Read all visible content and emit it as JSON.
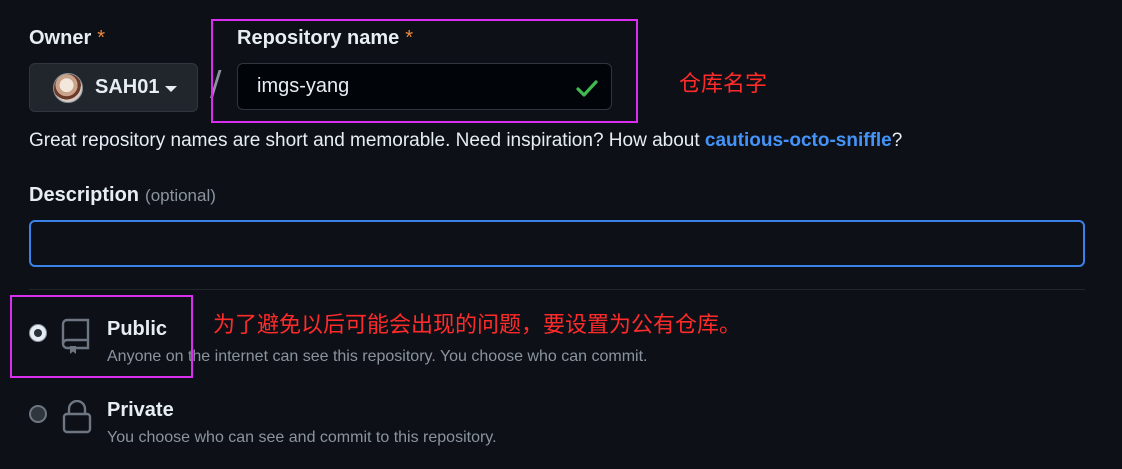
{
  "owner": {
    "label": "Owner",
    "required_mark": "*",
    "selected": "SAH01"
  },
  "separator": "/",
  "repository": {
    "label": "Repository name",
    "required_mark": "*",
    "value": "imgs-yang",
    "status_icon": "check-icon"
  },
  "hint": {
    "text": "Great repository names are short and memorable. Need inspiration? How about ",
    "suggestion": "cautious-octo-sniffle",
    "suffix": "?"
  },
  "description": {
    "label": "Description",
    "optional": "(optional)",
    "value": ""
  },
  "visibility": {
    "selected": "public",
    "options": [
      {
        "id": "public",
        "title": "Public",
        "description": "Anyone on the internet can see this repository. You choose who can commit.",
        "icon": "repo-icon"
      },
      {
        "id": "private",
        "title": "Private",
        "description": "You choose who can see and commit to this repository.",
        "icon": "lock-icon"
      }
    ]
  },
  "annotations": {
    "repo_name_note": "仓库名字",
    "public_note": "为了避免以后可能会出现的问题，要设置为公有仓库。",
    "highlight_color": "#d92ef0",
    "note_color": "#ff2a2a"
  },
  "colors": {
    "background": "#0d1117",
    "link": "#4493f8",
    "required": "#f0883e",
    "focus_border": "#3b82e8",
    "success": "#3fb950"
  }
}
